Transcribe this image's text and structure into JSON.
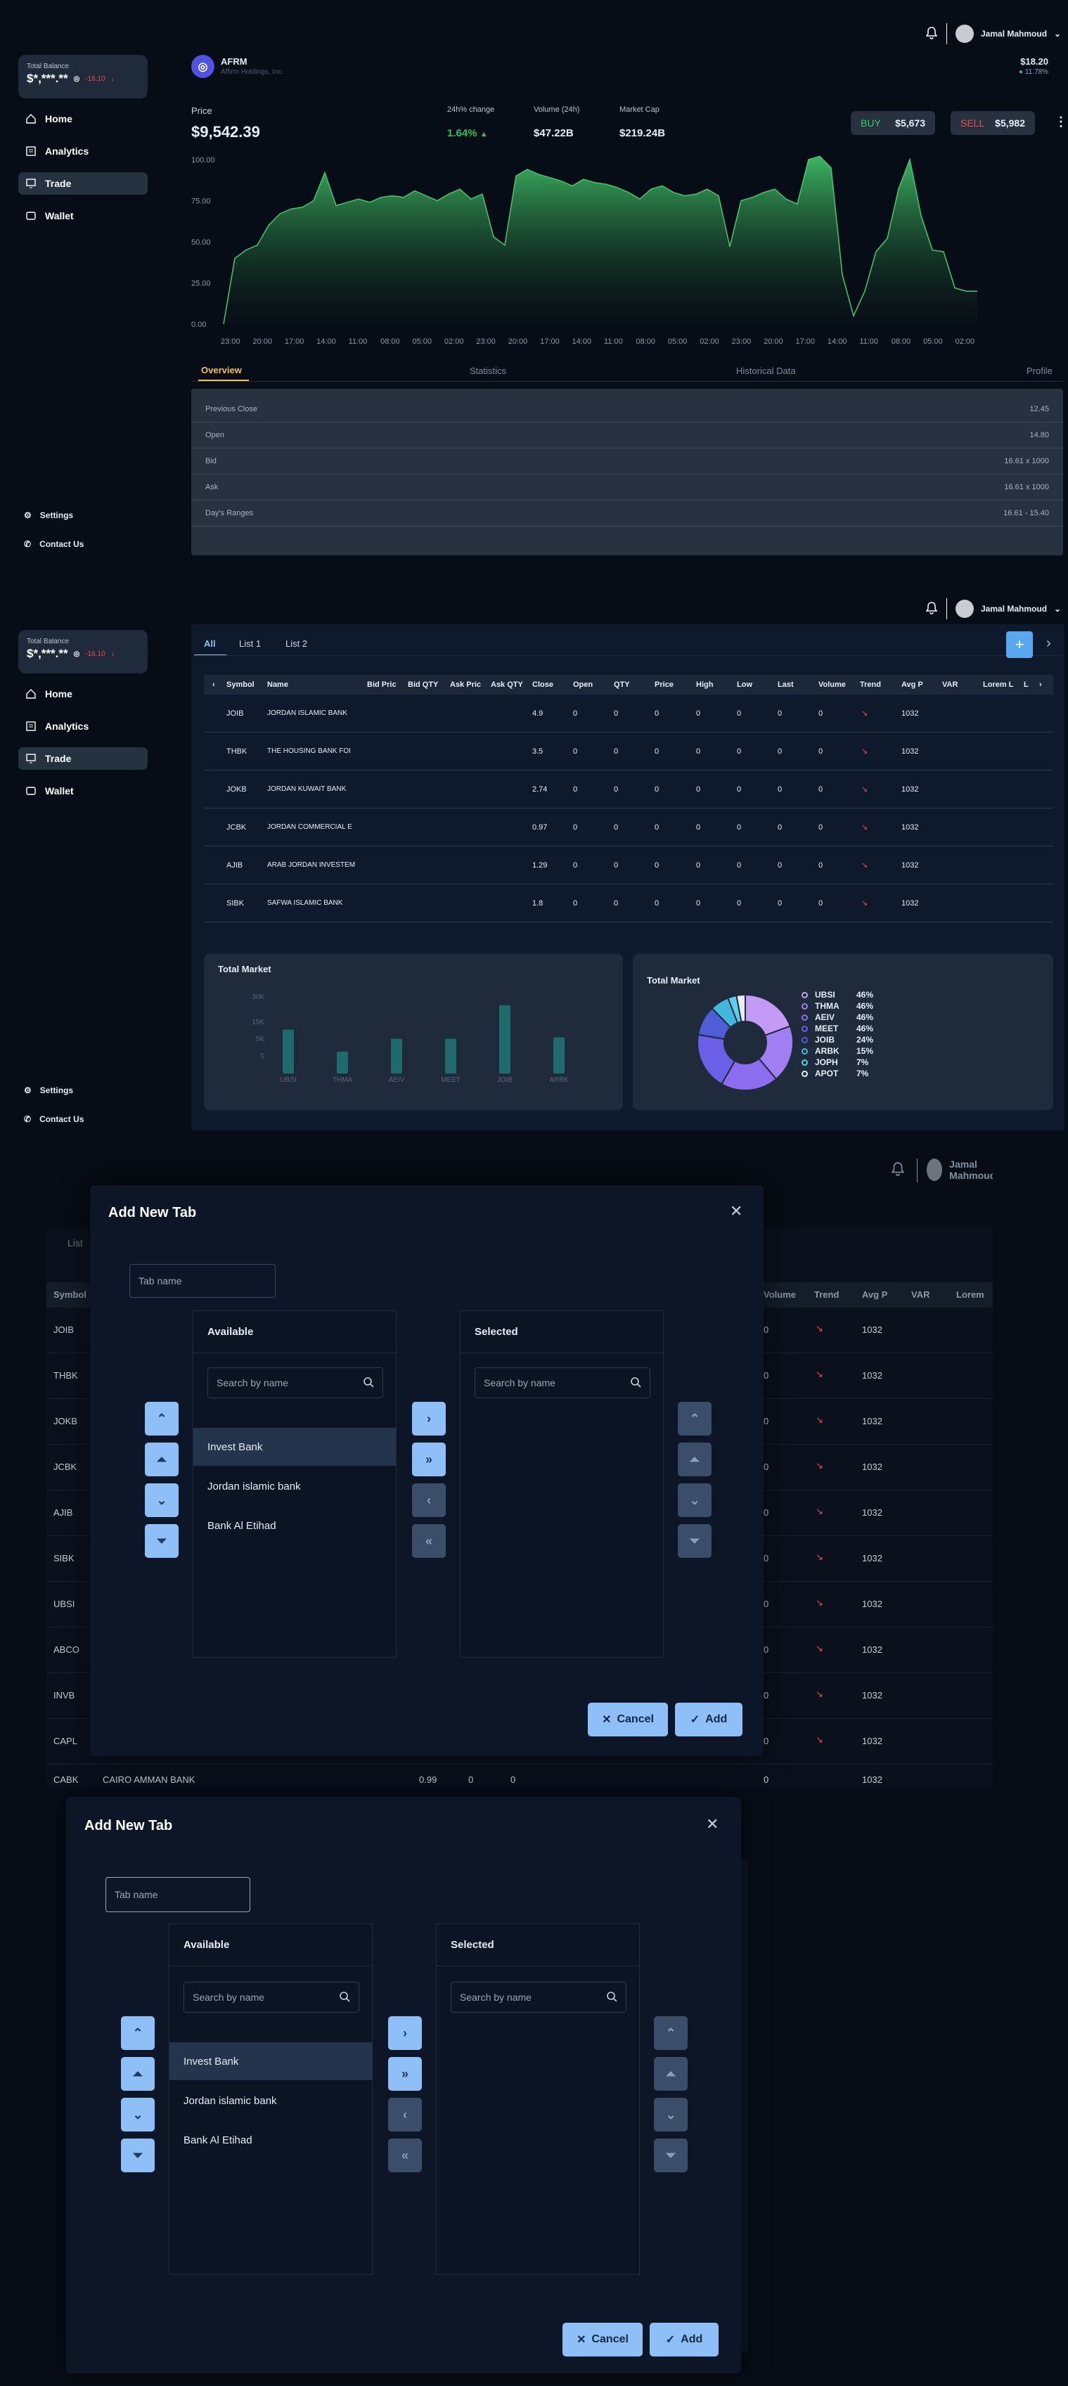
{
  "user": {
    "name": "Jamal Mahmoud"
  },
  "sidebar": {
    "balance_label": "Total Balance",
    "balance_value": "$*,***.**",
    "balance_change": "-16.10",
    "nav": [
      {
        "label": "Home"
      },
      {
        "label": "Analytics"
      },
      {
        "label": "Trade"
      },
      {
        "label": "Wallet"
      }
    ],
    "settings": "Settings",
    "contact": "Contact Us"
  },
  "stock": {
    "symbol": "AFRM",
    "company": "Affirm Holdings, Inc.",
    "price_label": "Price",
    "price": "$9,542.39",
    "change_label": "24h% change",
    "change": "1.64%",
    "volume_label": "Volume (24h)",
    "volume": "$47.22B",
    "mcap_label": "Market Cap",
    "mcap": "$219.24B",
    "top_price": "$18.20",
    "top_change": "11.78%",
    "buy_label": "BUY",
    "buy_value": "$5,673",
    "sell_label": "SELL",
    "sell_value": "$5,982",
    "tabs": [
      "Overview",
      "Statistics",
      "Historical Data",
      "Profile"
    ],
    "overview": [
      {
        "label": "Previous Close",
        "value": "12.45"
      },
      {
        "label": "Open",
        "value": "14.80"
      },
      {
        "label": "Bid",
        "value": "16.61 x 1000"
      },
      {
        "label": "Ask",
        "value": "16.61 x 1000"
      },
      {
        "label": "Day's Ranges",
        "value": "16.61 - 15.40"
      }
    ]
  },
  "chart_data": [
    {
      "type": "area",
      "ylim": [
        0,
        100
      ],
      "yticks": [
        "100.00",
        "75.00",
        "50.00",
        "25.00",
        "0.00"
      ],
      "x": [
        "23:00",
        "20:00",
        "17:00",
        "14:00",
        "11:00",
        "08:00",
        "05:00",
        "02:00",
        "23:00",
        "20:00",
        "17:00",
        "14:00",
        "11:00",
        "08:00",
        "05:00",
        "02:00",
        "23:00",
        "20:00",
        "17:00",
        "14:00",
        "11:00",
        "08:00",
        "05:00",
        "02:00"
      ],
      "values": [
        0,
        40,
        45,
        48,
        60,
        67,
        70,
        71,
        75,
        92,
        72,
        74,
        76,
        74,
        77,
        78,
        77,
        81,
        78,
        75,
        79,
        82,
        76,
        79,
        53,
        48,
        90,
        94,
        91,
        89,
        87,
        84,
        88,
        86,
        85,
        83,
        80,
        76,
        82,
        84,
        80,
        78,
        79,
        82,
        78,
        47,
        75,
        77,
        80,
        82,
        76,
        73,
        100,
        102,
        95,
        30,
        5,
        20,
        44,
        52,
        82,
        100,
        66,
        45,
        44,
        22,
        20,
        20
      ]
    },
    {
      "type": "bar",
      "title": "Total Market",
      "categories": [
        "UBSI",
        "THMA",
        "AEIV",
        "MEET",
        "JOIB",
        "ARBK"
      ],
      "yticks": [
        "30K",
        "15K",
        "5K",
        "0"
      ],
      "values": [
        17,
        8.5,
        13.5,
        13.5,
        26.5,
        14
      ],
      "ylim": [
        0,
        30
      ]
    },
    {
      "type": "pie",
      "title": "Total Market",
      "labels": [
        "UBSI",
        "THMA",
        "AEIV",
        "MEET",
        "JOIB",
        "ARBK",
        "JOPH",
        "APOT"
      ],
      "values": [
        46,
        46,
        46,
        46,
        24,
        15,
        7,
        7
      ],
      "colors": [
        "#c39bf7",
        "#a07ff2",
        "#8b6ef0",
        "#6b5fe8",
        "#4f5dd6",
        "#42b8db",
        "#5ad0eb",
        "#e8edf3"
      ]
    }
  ],
  "watchlist": {
    "tabs": [
      "All",
      "List 1",
      "List 2"
    ],
    "headers": [
      "Symbol",
      "Name",
      "Bid Pric",
      "Bid QTY",
      "Ask Pric",
      "Ask QTY",
      "Close",
      "Open",
      "QTY",
      "Price",
      "High",
      "Low",
      "Last",
      "Volume",
      "Trend",
      "Avg P",
      "VAR",
      "Lorem L",
      "L"
    ],
    "rows": [
      {
        "sym": "JOIB",
        "name": "JORDAN ISLAMIC BANK",
        "close": "4.9",
        "avg": "1032"
      },
      {
        "sym": "THBK",
        "name": "THE HOUSING BANK FOI",
        "close": "3.5",
        "avg": "1032"
      },
      {
        "sym": "JOKB",
        "name": "JORDAN KUWAIT BANK",
        "close": "2.74",
        "avg": "1032"
      },
      {
        "sym": "JCBK",
        "name": "JORDAN COMMERCIAL E",
        "close": "0.97",
        "avg": "1032"
      },
      {
        "sym": "AJIB",
        "name": "ARAB JORDAN INVESTEM",
        "close": "1.29",
        "avg": "1032"
      },
      {
        "sym": "SIBK",
        "name": "SAFWA ISLAMIC BANK",
        "close": "1.8",
        "avg": "1032"
      }
    ],
    "zero": "0"
  },
  "bg_table": {
    "tab": "List",
    "headers": [
      "Symbol",
      "Volume",
      "Trend",
      "Avg P",
      "VAR",
      "Lorem"
    ],
    "syms": [
      "JOIB",
      "THBK",
      "JOKB",
      "JCBK",
      "AJIB",
      "SIBK",
      "UBSI",
      "ABCO",
      "INVB",
      "CAPL"
    ],
    "last_sym": "CABK",
    "last_name": "CAIRO AMMAN BANK",
    "last_close": "0.99"
  },
  "modal": {
    "title": "Add New Tab",
    "tab_placeholder": "Tab name",
    "available": "Available",
    "selected": "Selected",
    "search_placeholder": "Search by name",
    "items": [
      "Invest Bank",
      "Jordan islamic bank",
      "Bank Al Etihad"
    ],
    "cancel": "Cancel",
    "add": "Add"
  }
}
